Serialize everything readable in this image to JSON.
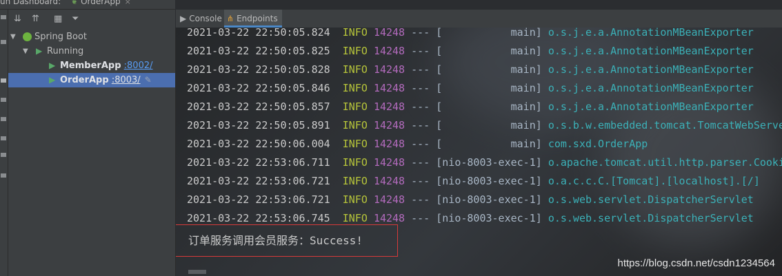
{
  "header": {
    "dashboard_label": "un Dashboard:",
    "app_tab_label": "OrderApp",
    "close_glyph": "×"
  },
  "tree": {
    "root": {
      "label": "Spring Boot"
    },
    "group": {
      "label": "Running"
    },
    "items": [
      {
        "name": "MemberApp",
        "port": ":8002/",
        "selected": false
      },
      {
        "name": "OrderApp",
        "port": ":8003/",
        "selected": true
      }
    ]
  },
  "tabs": [
    {
      "label": "Console",
      "icon": "console-icon",
      "active": false
    },
    {
      "label": "Endpoints",
      "icon": "endpoints-icon",
      "active": true
    }
  ],
  "console": {
    "lines": [
      {
        "ts": "2021-03-22 22:50:05.824",
        "level": "INFO",
        "pid": "14248",
        "dashes": "---",
        "thread": "[           main]",
        "cls": "o.s.j.e.a.AnnotationMBeanExporter"
      },
      {
        "ts": "2021-03-22 22:50:05.825",
        "level": "INFO",
        "pid": "14248",
        "dashes": "---",
        "thread": "[           main]",
        "cls": "o.s.j.e.a.AnnotationMBeanExporter"
      },
      {
        "ts": "2021-03-22 22:50:05.828",
        "level": "INFO",
        "pid": "14248",
        "dashes": "---",
        "thread": "[           main]",
        "cls": "o.s.j.e.a.AnnotationMBeanExporter"
      },
      {
        "ts": "2021-03-22 22:50:05.846",
        "level": "INFO",
        "pid": "14248",
        "dashes": "---",
        "thread": "[           main]",
        "cls": "o.s.j.e.a.AnnotationMBeanExporter"
      },
      {
        "ts": "2021-03-22 22:50:05.857",
        "level": "INFO",
        "pid": "14248",
        "dashes": "---",
        "thread": "[           main]",
        "cls": "o.s.j.e.a.AnnotationMBeanExporter"
      },
      {
        "ts": "2021-03-22 22:50:05.891",
        "level": "INFO",
        "pid": "14248",
        "dashes": "---",
        "thread": "[           main]",
        "cls": "o.s.b.w.embedded.tomcat.TomcatWebServe"
      },
      {
        "ts": "2021-03-22 22:50:06.004",
        "level": "INFO",
        "pid": "14248",
        "dashes": "---",
        "thread": "[           main]",
        "cls": "com.sxd.OrderApp"
      },
      {
        "ts": "2021-03-22 22:53:06.711",
        "level": "INFO",
        "pid": "14248",
        "dashes": "---",
        "thread": "[nio-8003-exec-1]",
        "cls": "o.apache.tomcat.util.http.parser.Cooki"
      },
      {
        "ts": "2021-03-22 22:53:06.721",
        "level": "INFO",
        "pid": "14248",
        "dashes": "---",
        "thread": "[nio-8003-exec-1]",
        "cls": "o.a.c.c.C.[Tomcat].[localhost].[/]"
      },
      {
        "ts": "2021-03-22 22:53:06.721",
        "level": "INFO",
        "pid": "14248",
        "dashes": "---",
        "thread": "[nio-8003-exec-1]",
        "cls": "o.s.web.servlet.DispatcherServlet"
      },
      {
        "ts": "2021-03-22 22:53:06.745",
        "level": "INFO",
        "pid": "14248",
        "dashes": "---",
        "thread": "[nio-8003-exec-1]",
        "cls": "o.s.web.servlet.DispatcherServlet"
      }
    ],
    "output_text": "订单服务调用会员服务：Success!",
    "highlight_color": "#d83a3a"
  },
  "watermark": "https://blog.csdn.net/csdn1234564"
}
